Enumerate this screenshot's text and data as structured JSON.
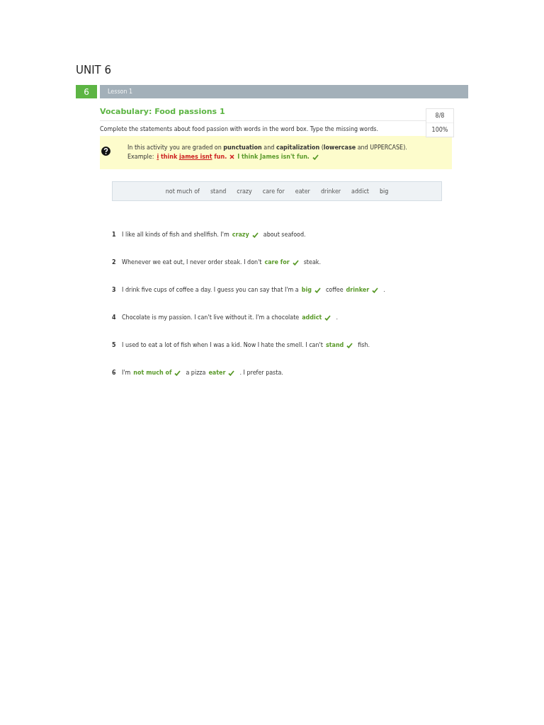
{
  "unit_title": "UNIT 6",
  "lesson_bar": {
    "number": "6",
    "label": "Lesson 1"
  },
  "activity": {
    "title": "Vocabulary: Food passions 1",
    "instructions": "Complete the statements about food passion with words in the word box. Type the missing words.",
    "score": {
      "points": "8/8",
      "percent": "100%"
    }
  },
  "notice": {
    "text": "In this activity you are graded on **punctuation** and **capitalization** (**lowercase** and UPPERCASE).",
    "example_label": "Example:",
    "examples": [
      {
        "correct": false,
        "parts": [
          {
            "text": "i",
            "error": true
          },
          {
            "text": " think ",
            "error": false
          },
          {
            "text": "james isnt",
            "error": true
          },
          {
            "text": " fun.",
            "error": false
          }
        ]
      },
      {
        "correct": true,
        "parts": [
          {
            "text": "I think James isn't fun.",
            "error": false
          }
        ]
      }
    ]
  },
  "word_box": [
    "not much of",
    "stand",
    "crazy",
    "care for",
    "eater",
    "drinker",
    "addict",
    "big"
  ],
  "sentences": [
    {
      "number": "1",
      "segments": [
        {
          "kind": "text",
          "text": "I like all kinds of fish and shellfish. I'm"
        },
        {
          "kind": "answer",
          "text": "crazy",
          "correct": true
        },
        {
          "kind": "text",
          "text": "about seafood."
        }
      ]
    },
    {
      "number": "2",
      "segments": [
        {
          "kind": "text",
          "text": "Whenever we eat out, I never order steak. I don't"
        },
        {
          "kind": "answer",
          "text": "care for",
          "correct": true
        },
        {
          "kind": "text",
          "text": "steak."
        }
      ]
    },
    {
      "number": "3",
      "segments": [
        {
          "kind": "text",
          "text": "I drink five cups of coffee a day. I guess you can say that I'm a"
        },
        {
          "kind": "answer",
          "text": "big",
          "correct": true
        },
        {
          "kind": "text",
          "text": "coffee"
        },
        {
          "kind": "answer",
          "text": "drinker",
          "correct": true
        },
        {
          "kind": "text",
          "text": "."
        }
      ]
    },
    {
      "number": "4",
      "segments": [
        {
          "kind": "text",
          "text": "Chocolate is my passion. I can't live without it. I'm a chocolate"
        },
        {
          "kind": "answer",
          "text": "addict",
          "correct": true
        },
        {
          "kind": "text",
          "text": "."
        }
      ]
    },
    {
      "number": "5",
      "segments": [
        {
          "kind": "text",
          "text": "I used to eat a lot of fish when I was a kid. Now I hate the smell. I can't"
        },
        {
          "kind": "answer",
          "text": "stand",
          "correct": true
        },
        {
          "kind": "text",
          "text": "fish."
        }
      ]
    },
    {
      "number": "6",
      "segments": [
        {
          "kind": "text",
          "text": "I'm"
        },
        {
          "kind": "answer",
          "text": "not much of",
          "correct": true
        },
        {
          "kind": "text",
          "text": "a pizza"
        },
        {
          "kind": "answer",
          "text": "eater",
          "correct": true
        },
        {
          "kind": "text",
          "text": ". I prefer pasta."
        }
      ]
    }
  ]
}
